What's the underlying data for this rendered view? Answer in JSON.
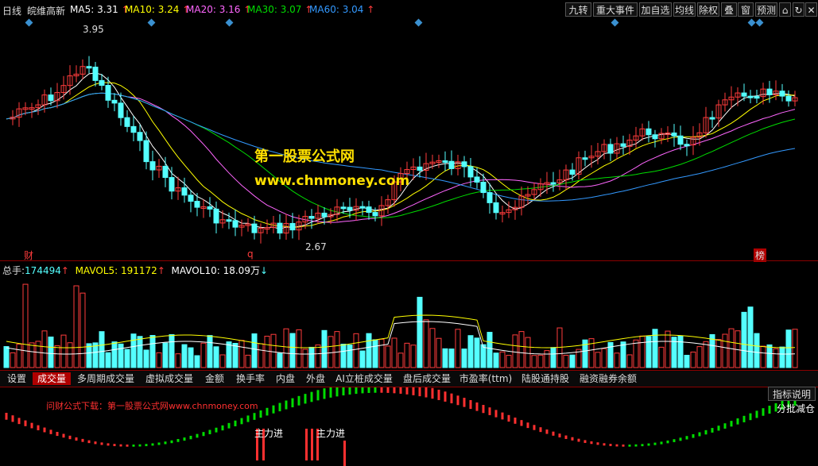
{
  "header": {
    "period": "日线",
    "stock_name": "皖维高新",
    "ma": [
      {
        "label": "MA5:",
        "value": "3.31",
        "color": "#ffffff"
      },
      {
        "label": "MA10:",
        "value": "3.24",
        "color": "#ffff00"
      },
      {
        "label": "MA20:",
        "value": "3.16",
        "color": "#ff66ff"
      },
      {
        "label": "MA30:",
        "value": "3.07",
        "color": "#00dd00"
      },
      {
        "label": "MA60:",
        "value": "3.04",
        "color": "#3399ff"
      }
    ],
    "up_arrow": "↑",
    "buttons": [
      "九转",
      "重大事件",
      "加自选",
      "均线",
      "除权",
      "叠",
      "窗",
      "预测"
    ],
    "icons": [
      "lock-icon",
      "refresh-icon",
      "close-icon"
    ]
  },
  "price_chart": {
    "high_marker": "3.95",
    "low_marker": "2.67",
    "bottom_tags": {
      "cai": "财",
      "q": "q",
      "bang": "榜"
    },
    "watermark_cn": "第一股票公式网",
    "watermark_url": "www.chnmoney.com"
  },
  "volume_panel": {
    "label": "总手:",
    "value": "174494",
    "vol5_label": "MAVOL5:",
    "vol5_value": "191172",
    "vol10_label": "MAVOL10:",
    "vol10_value": "18.09万",
    "down_arrow": "↓"
  },
  "tabs": [
    "设置",
    "成交量",
    "多周期成交量",
    "虚拟成交量",
    "金额",
    "换手率",
    "内盘",
    "外盘",
    "AI立桩成交量",
    "盘后成交量",
    "市盈率(ttm)",
    "陆股通持股",
    "融资融券余额"
  ],
  "indicator_panel": {
    "explain_button": "指标说明",
    "ad_text": "问财公式下载：第一股票公式网www.chnmoney.com",
    "main_force_labels": [
      "主力进",
      "主力进"
    ],
    "right_note": "分批减仓"
  },
  "colors": {
    "up": "#ff3c3c",
    "down": "#54ffff",
    "ma5": "#ffffff",
    "ma10": "#ffff00",
    "ma20": "#ff66ff",
    "ma30": "#00dd00",
    "ma60": "#3399ff",
    "indicator_up": "#ff3030",
    "indicator_down": "#00dd00"
  }
}
